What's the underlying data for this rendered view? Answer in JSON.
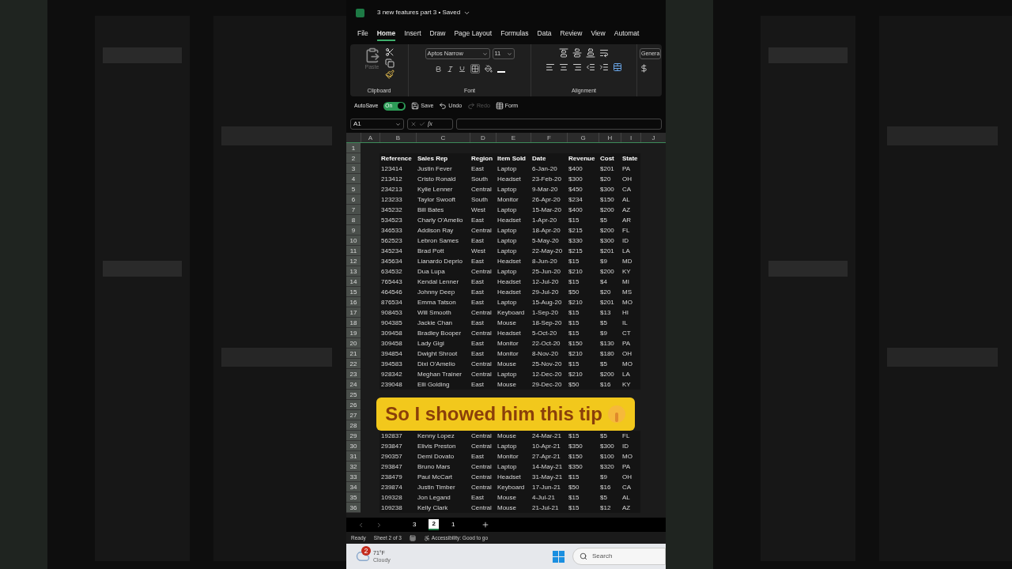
{
  "title_bar": {
    "title": "3 new features part 3 • Saved"
  },
  "menu_tabs": [
    {
      "label": "File",
      "selected": false
    },
    {
      "label": "Home",
      "selected": true
    },
    {
      "label": "Insert",
      "selected": false
    },
    {
      "label": "Draw",
      "selected": false
    },
    {
      "label": "Page Layout",
      "selected": false
    },
    {
      "label": "Formulas",
      "selected": false
    },
    {
      "label": "Data",
      "selected": false
    },
    {
      "label": "Review",
      "selected": false
    },
    {
      "label": "View",
      "selected": false
    },
    {
      "label": "Automat",
      "selected": false
    }
  ],
  "ribbon": {
    "paste": "Paste",
    "font_name": "Aptos Narrow",
    "font_size": "11",
    "number_format": "Genera",
    "groups": [
      "Clipboard",
      "Font",
      "Alignment"
    ]
  },
  "quick_access": {
    "autosave": "AutoSave",
    "toggle": {
      "label": "On",
      "on": true
    },
    "buttons": [
      {
        "label": "Save",
        "disabled": false
      },
      {
        "label": "Undo",
        "disabled": false
      },
      {
        "label": "Redo",
        "disabled": true
      },
      {
        "label": "Form",
        "disabled": false
      }
    ]
  },
  "formula_bar": {
    "name_box": "A1",
    "fx": "fx"
  },
  "columns": [
    "A",
    "B",
    "C",
    "D",
    "E",
    "F",
    "G",
    "H",
    "I",
    "J"
  ],
  "rows": [
    {
      "n": "1",
      "kind": "empty"
    },
    {
      "n": "2",
      "kind": "header",
      "cells": [
        "Reference",
        "Sales Rep",
        "Region",
        "Item Sold",
        "Date",
        "Revenue",
        "Cost",
        "State"
      ]
    },
    {
      "n": "3",
      "kind": "data",
      "cells": [
        "123414",
        "Justin Fever",
        "East",
        "Laptop",
        "6-Jan-20",
        "$400",
        "$201",
        "PA"
      ]
    },
    {
      "n": "4",
      "kind": "data",
      "cells": [
        "213412",
        "Cristo Ronald",
        "South",
        "Headset",
        "23-Feb-20",
        "$300",
        "$20",
        "OH"
      ]
    },
    {
      "n": "5",
      "kind": "data",
      "cells": [
        "234213",
        "Kylie Lenner",
        "Central",
        "Laptop",
        "9-Mar-20",
        "$450",
        "$300",
        "CA"
      ]
    },
    {
      "n": "6",
      "kind": "data",
      "cells": [
        "123233",
        "Taylor Swooft",
        "South",
        "Monitor",
        "26-Apr-20",
        "$234",
        "$150",
        "AL"
      ]
    },
    {
      "n": "7",
      "kind": "data",
      "cells": [
        "345232",
        "Bill Bates",
        "West",
        "Laptop",
        "15-Mar-20",
        "$400",
        "$200",
        "AZ"
      ]
    },
    {
      "n": "8",
      "kind": "data",
      "cells": [
        "534523",
        "Charly O'Amelio",
        "East",
        "Headset",
        "1-Apr-20",
        "$15",
        "$5",
        "AR"
      ]
    },
    {
      "n": "9",
      "kind": "data",
      "cells": [
        "346533",
        "Addison Ray",
        "Central",
        "Laptop",
        "18-Apr-20",
        "$215",
        "$200",
        "FL"
      ]
    },
    {
      "n": "10",
      "kind": "data",
      "cells": [
        "562523",
        "Lebron Sames",
        "East",
        "Laptop",
        "5-May-20",
        "$330",
        "$300",
        "ID"
      ]
    },
    {
      "n": "11",
      "kind": "data",
      "cells": [
        "345234",
        "Brad Pott",
        "West",
        "Laptop",
        "22-May-20",
        "$215",
        "$201",
        "LA"
      ]
    },
    {
      "n": "12",
      "kind": "data",
      "cells": [
        "345634",
        "Lianardo Deprio",
        "East",
        "Headset",
        "8-Jun-20",
        "$15",
        "$9",
        "MD"
      ]
    },
    {
      "n": "13",
      "kind": "data",
      "cells": [
        "634532",
        "Dua Lupa",
        "Central",
        "Laptop",
        "25-Jun-20",
        "$210",
        "$200",
        "KY"
      ]
    },
    {
      "n": "14",
      "kind": "data",
      "cells": [
        "765443",
        "Kendal Lenner",
        "East",
        "Headset",
        "12-Jul-20",
        "$15",
        "$4",
        "MI"
      ]
    },
    {
      "n": "15",
      "kind": "data",
      "cells": [
        "464546",
        "Johnny Deep",
        "East",
        "Headset",
        "29-Jul-20",
        "$50",
        "$20",
        "MS"
      ]
    },
    {
      "n": "16",
      "kind": "data",
      "cells": [
        "876534",
        "Emma Tatson",
        "East",
        "Laptop",
        "15-Aug-20",
        "$210",
        "$201",
        "MO"
      ]
    },
    {
      "n": "17",
      "kind": "data",
      "cells": [
        "908453",
        "Will Smooth",
        "Central",
        "Keyboard",
        "1-Sep-20",
        "$15",
        "$13",
        "HI"
      ]
    },
    {
      "n": "18",
      "kind": "data",
      "cells": [
        "904385",
        "Jackie Chan",
        "East",
        "Mouse",
        "18-Sep-20",
        "$15",
        "$5",
        "IL"
      ]
    },
    {
      "n": "19",
      "kind": "data",
      "cells": [
        "309458",
        "Bradley Booper",
        "Central",
        "Headset",
        "5-Oct-20",
        "$15",
        "$9",
        "CT"
      ]
    },
    {
      "n": "20",
      "kind": "data",
      "cells": [
        "309458",
        "Lady Gigi",
        "East",
        "Monitor",
        "22-Oct-20",
        "$150",
        "$130",
        "PA"
      ]
    },
    {
      "n": "21",
      "kind": "data",
      "cells": [
        "394854",
        "Dwight Shroot",
        "East",
        "Monitor",
        "8-Nov-20",
        "$210",
        "$180",
        "OH"
      ]
    },
    {
      "n": "22",
      "kind": "data",
      "cells": [
        "394583",
        "Dixi O'Amelio",
        "Central",
        "Mouse",
        "25-Nov-20",
        "$15",
        "$5",
        "MO"
      ]
    },
    {
      "n": "23",
      "kind": "data",
      "cells": [
        "928342",
        "Meghan Trainer",
        "Central",
        "Laptop",
        "12-Dec-20",
        "$210",
        "$200",
        "LA"
      ]
    },
    {
      "n": "24",
      "kind": "data",
      "cells": [
        "239048",
        "Elli Golding",
        "East",
        "Mouse",
        "29-Dec-20",
        "$50",
        "$16",
        "KY"
      ]
    },
    {
      "n": "25",
      "kind": "empty"
    },
    {
      "n": "26",
      "kind": "empty"
    },
    {
      "n": "27",
      "kind": "empty"
    },
    {
      "n": "28",
      "kind": "empty"
    },
    {
      "n": "29",
      "kind": "data",
      "cells": [
        "192837",
        "Kenny Lopez",
        "Central",
        "Mouse",
        "24-Mar-21",
        "$15",
        "$5",
        "FL"
      ]
    },
    {
      "n": "30",
      "kind": "data",
      "cells": [
        "293847",
        "Elivis Preston",
        "Central",
        "Laptop",
        "10-Apr-21",
        "$350",
        "$300",
        "ID"
      ]
    },
    {
      "n": "31",
      "kind": "data",
      "cells": [
        "290357",
        "Demi Dovato",
        "East",
        "Monitor",
        "27-Apr-21",
        "$150",
        "$100",
        "MO"
      ]
    },
    {
      "n": "32",
      "kind": "data",
      "cells": [
        "293847",
        "Bruno Mars",
        "Central",
        "Laptop",
        "14-May-21",
        "$350",
        "$320",
        "PA"
      ]
    },
    {
      "n": "33",
      "kind": "data",
      "cells": [
        "238479",
        "Paul McCart",
        "Central",
        "Headset",
        "31-May-21",
        "$15",
        "$9",
        "OH"
      ]
    },
    {
      "n": "34",
      "kind": "data",
      "cells": [
        "239874",
        "Justin Timber",
        "Central",
        "Keyboard",
        "17-Jun-21",
        "$50",
        "$16",
        "CA"
      ]
    },
    {
      "n": "35",
      "kind": "data",
      "cells": [
        "109328",
        "Jon Legand",
        "East",
        "Mouse",
        "4-Jul-21",
        "$15",
        "$5",
        "AL"
      ]
    },
    {
      "n": "36",
      "kind": "data",
      "cells": [
        "109238",
        "Kelly Clark",
        "Central",
        "Mouse",
        "21-Jul-21",
        "$15",
        "$12",
        "AZ"
      ]
    }
  ],
  "caption": "So I showed him this tip",
  "sheet_tabs": [
    {
      "label": "3",
      "selected": false
    },
    {
      "label": "2",
      "selected": true
    },
    {
      "label": "1",
      "selected": false
    }
  ],
  "status_bar": {
    "ready": "Ready",
    "sheet": "Sheet 2 of 3",
    "accessibility": "Accessibility: Good to go"
  },
  "taskbar": {
    "badge": "2",
    "temperature": "71°F",
    "weather": "Cloudy",
    "search": "Search"
  }
}
